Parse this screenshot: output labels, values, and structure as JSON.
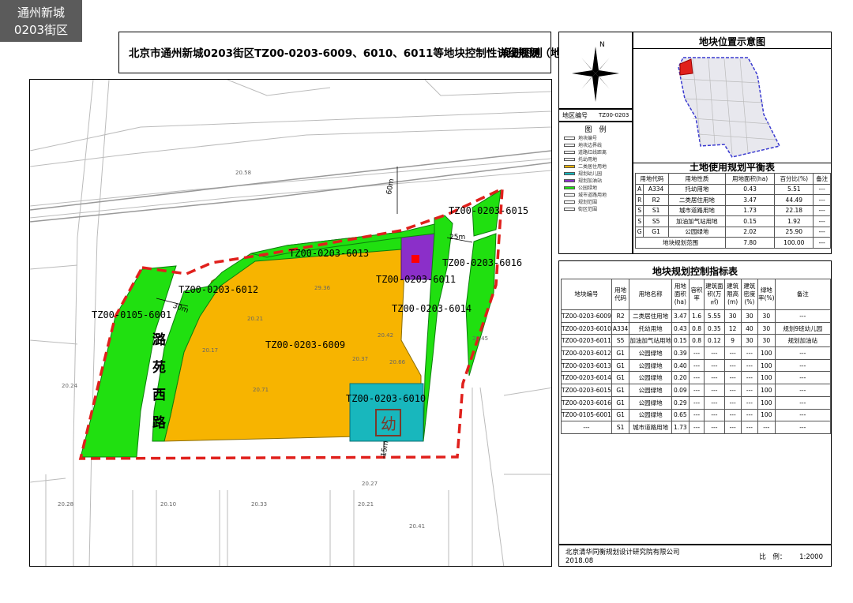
{
  "district_label": {
    "line1": "通州新城",
    "line2": "0203街区"
  },
  "header": {
    "title": "北京市通州新城0203街区TZ00-0203-6009、6010、6011等地块控制性详细规划（地块层面）",
    "subtitle": "规划图则"
  },
  "compass": {
    "north": "N"
  },
  "district_code": {
    "label": "地区编号",
    "value": "TZ00-0203"
  },
  "legend": {
    "title": "图　例",
    "items": [
      {
        "label": "地块编号",
        "color": "#ffffff"
      },
      {
        "label": "地块边界线",
        "color": "#ffffff"
      },
      {
        "label": "道路红线距离",
        "color": "#ffffff"
      },
      {
        "label": "托幼用地",
        "color": "#ffffff"
      },
      {
        "label": "二类居住用地",
        "color": "#f7b400"
      },
      {
        "label": "规划幼儿园",
        "color": "#18b7bd"
      },
      {
        "label": "规划加油站",
        "color": "#8b2fc9"
      },
      {
        "label": "公园绿地",
        "color": "#20e010"
      },
      {
        "label": "城市道路用地",
        "color": "#ffffff"
      },
      {
        "label": "规划范围",
        "color": "#ffffff"
      },
      {
        "label": "街区范围",
        "color": "#ffffff"
      }
    ]
  },
  "overview": {
    "title": "地块位置示意图"
  },
  "landuse": {
    "title": "土地使用规划平衡表",
    "headers": [
      "用地代码",
      "",
      "用地性质",
      "用地面积(ha)",
      "百分比(%)",
      "备注"
    ],
    "rows": [
      [
        "A",
        "A334",
        "托幼用地",
        "0.43",
        "5.51",
        "---"
      ],
      [
        "R",
        "R2",
        "二类居住用地",
        "3.47",
        "44.49",
        "---"
      ],
      [
        "S",
        "S1",
        "城市道路用地",
        "1.73",
        "22.18",
        "---"
      ],
      [
        "S",
        "S5",
        "加油加气站用地",
        "0.15",
        "1.92",
        "---"
      ],
      [
        "G",
        "G1",
        "公园绿地",
        "2.02",
        "25.90",
        "---"
      ]
    ],
    "total": [
      "地块规划范围",
      "7.80",
      "100.00",
      "---"
    ]
  },
  "index": {
    "title": "地块规划控制指标表",
    "headers": [
      "地块编号",
      "用地代码",
      "用地名称",
      "用地面积(ha)",
      "容积率",
      "建筑面积(万㎡)",
      "建筑限高(m)",
      "建筑密度(%)",
      "绿地率(%)",
      "备注"
    ],
    "rows": [
      [
        "TZ00-0203-6009",
        "R2",
        "二类居住用地",
        "3.47",
        "1.6",
        "5.55",
        "30",
        "30",
        "30",
        "---"
      ],
      [
        "TZ00-0203-6010",
        "A334",
        "托幼用地",
        "0.43",
        "0.8",
        "0.35",
        "12",
        "40",
        "30",
        "规划9班幼儿园"
      ],
      [
        "TZ00-0203-6011",
        "S5",
        "加油加气站用地",
        "0.15",
        "0.8",
        "0.12",
        "9",
        "30",
        "30",
        "规划加油站"
      ],
      [
        "TZ00-0203-6012",
        "G1",
        "公园绿地",
        "0.39",
        "---",
        "---",
        "---",
        "---",
        "100",
        "---"
      ],
      [
        "TZ00-0203-6013",
        "G1",
        "公园绿地",
        "0.40",
        "---",
        "---",
        "---",
        "---",
        "100",
        "---"
      ],
      [
        "TZ00-0203-6014",
        "G1",
        "公园绿地",
        "0.20",
        "---",
        "---",
        "---",
        "---",
        "100",
        "---"
      ],
      [
        "TZ00-0203-6015",
        "G1",
        "公园绿地",
        "0.09",
        "---",
        "---",
        "---",
        "---",
        "100",
        "---"
      ],
      [
        "TZ00-0203-6016",
        "G1",
        "公园绿地",
        "0.29",
        "---",
        "---",
        "---",
        "---",
        "100",
        "---"
      ],
      [
        "TZ00-0105-6001",
        "G1",
        "公园绿地",
        "0.65",
        "---",
        "---",
        "---",
        "---",
        "100",
        "---"
      ],
      [
        "---",
        "S1",
        "城市道路用地",
        "1.73",
        "---",
        "---",
        "---",
        "---",
        "---",
        "---"
      ]
    ]
  },
  "footer": {
    "org": "北京清华同衡规划设计研究院有限公司",
    "date": "2018.08",
    "scale_label": "比　例：",
    "scale_value": "1:2000"
  },
  "map": {
    "road_name": [
      "潞",
      "苑",
      "西",
      "路"
    ],
    "dims": {
      "d60": "60m",
      "d25": "25m",
      "d30": "30m",
      "d15": "15m"
    },
    "plots": {
      "p6009": "TZ00-0203-6009",
      "p6010": "TZ00-0203-6010",
      "p6011": "TZ00-0203-6011",
      "p6012": "TZ00-0203-6012",
      "p6013": "TZ00-0203-6013",
      "p6014": "TZ00-0203-6014",
      "p6015": "TZ00-0203-6015",
      "p6016": "TZ00-0203-6016",
      "p6001": "TZ00-0105-6001"
    },
    "kindergarten_char": "幼",
    "elevations": [
      "29.36",
      "20.21",
      "20.17",
      "20.37",
      "20.42",
      "20.66",
      "20.71",
      "20.27",
      "20.33",
      "20.41",
      "20.21",
      "20.10",
      "20.45",
      "20.24",
      "20.28",
      "20.58"
    ],
    "colors": {
      "residential": "#f7b400",
      "green": "#20e010",
      "kindergarten": "#18b7bd",
      "gas": "#8b2fc9",
      "boundary": "#e0201c"
    }
  }
}
